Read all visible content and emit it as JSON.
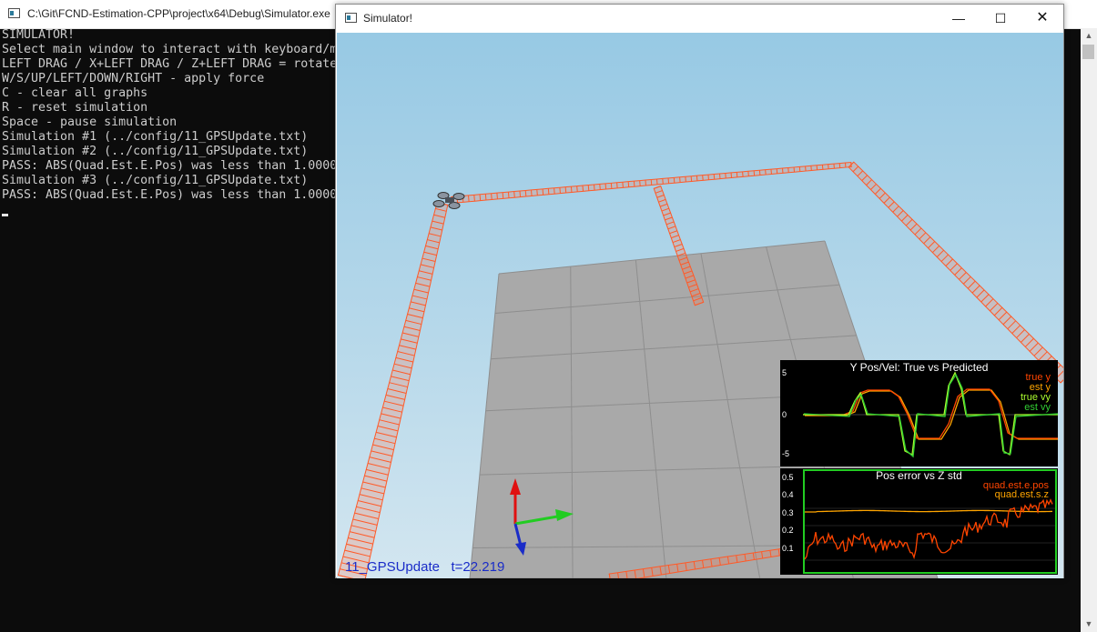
{
  "console": {
    "title": "C:\\Git\\FCND-Estimation-CPP\\project\\x64\\Debug\\Simulator.exe",
    "lines": [
      "SIMULATOR!",
      "Select main window to interact with keyboard/m",
      "LEFT DRAG / X+LEFT DRAG / Z+LEFT DRAG = rotate",
      "W/S/UP/LEFT/DOWN/RIGHT - apply force",
      "C - clear all graphs",
      "R - reset simulation",
      "Space - pause simulation",
      "Simulation #1 (../config/11_GPSUpdate.txt)",
      "Simulation #2 (../config/11_GPSUpdate.txt)",
      "PASS: ABS(Quad.Est.E.Pos) was less than 1.0000",
      "Simulation #3 (../config/11_GPSUpdate.txt)",
      "PASS: ABS(Quad.Est.E.Pos) was less than 1.0000"
    ]
  },
  "simulator": {
    "title": "Simulator!",
    "minimize_symbol": "—",
    "maximize_symbol": "☐",
    "close_symbol": "✕",
    "status": {
      "config": "11_GPSUpdate",
      "time": "t=22.219"
    }
  },
  "graph1": {
    "title": "Y Pos/Vel: True vs Predicted",
    "y_ticks": [
      "5",
      "0",
      "-5"
    ],
    "legend": [
      {
        "label": "true y",
        "color": "#ff4500"
      },
      {
        "label": "est y",
        "color": "#ffa500"
      },
      {
        "label": "true vy",
        "color": "#adff2f"
      },
      {
        "label": "est vy",
        "color": "#32cd32"
      }
    ]
  },
  "graph2": {
    "title": "Pos error vs Z std",
    "y_ticks": [
      "0.5",
      "0.4",
      "0.3",
      "0.2",
      "0.1"
    ],
    "legend": [
      {
        "label": "quad.est.e.pos",
        "color": "#ff4500"
      },
      {
        "label": "quad.est.s.z",
        "color": "#ffa500"
      }
    ],
    "border_color": "#22cc22"
  },
  "colors": {
    "trail": "#ff5a28",
    "axis_x": "#22cc22",
    "axis_y": "#1a2cc8",
    "axis_z": "#e01010"
  }
}
